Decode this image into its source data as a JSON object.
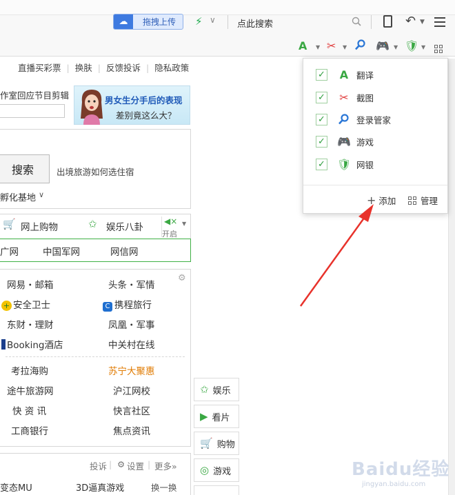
{
  "toolbar": {
    "upload_label": "拖拽上传",
    "search_label": "点此搜索"
  },
  "page": {
    "top_links": [
      "直播买彩票",
      "换肤",
      "反馈投诉",
      "隐私政策"
    ],
    "promo": {
      "caption": "作室回应节目剪辑",
      "title": "男女生分手后的表现",
      "subtitle": "差别竟这么大？"
    },
    "search": {
      "button_label": "搜索",
      "hint": "出境旅游如何选住宿",
      "location": "孵化基地"
    },
    "shop_tabs": {
      "tab1": "网上购物",
      "tab2": "娱乐八卦",
      "mute_label": "开启"
    },
    "green_links": [
      "广网",
      "中国军网",
      "网信网"
    ],
    "sites": {
      "r1c1": "网易・邮箱",
      "r1c2": "头条・军情",
      "r2c1": "安全卫士",
      "r2c2": "携程旅行",
      "r3c1": "东财・理财",
      "r3c2": "凤凰・军事",
      "r4c1": "Booking酒店",
      "r4c2": "中关村在线",
      "r5c1": "考拉海购",
      "r5c2": "苏宁大聚惠",
      "r6c1": "途牛旅游网",
      "r6c2": "沪江网校",
      "r7c1": "快 资 讯",
      "r7c2": "快言社区",
      "r8c1": "工商银行",
      "r8c2": "焦点资讯"
    },
    "bottom": {
      "complain": "投诉",
      "settings": "设置",
      "more": "更多»",
      "item1": "变态MU",
      "item2": "3D逼真游戏",
      "refresh": "换一换"
    },
    "side_tabs": [
      "娱乐",
      "看片",
      "购物",
      "游戏"
    ]
  },
  "popup": {
    "items": [
      "翻译",
      "截图",
      "登录管家",
      "游戏",
      "网银"
    ],
    "add_label": "添加",
    "manage_label": "管理"
  },
  "watermark": {
    "main": "Baidu经验",
    "sub": "jingyan.baidu.com"
  },
  "colors": {
    "accent_green": "#3aa843",
    "link_blue": "#1f5ab8",
    "orange": "#e07a00",
    "arrow_red": "#e8322b"
  }
}
